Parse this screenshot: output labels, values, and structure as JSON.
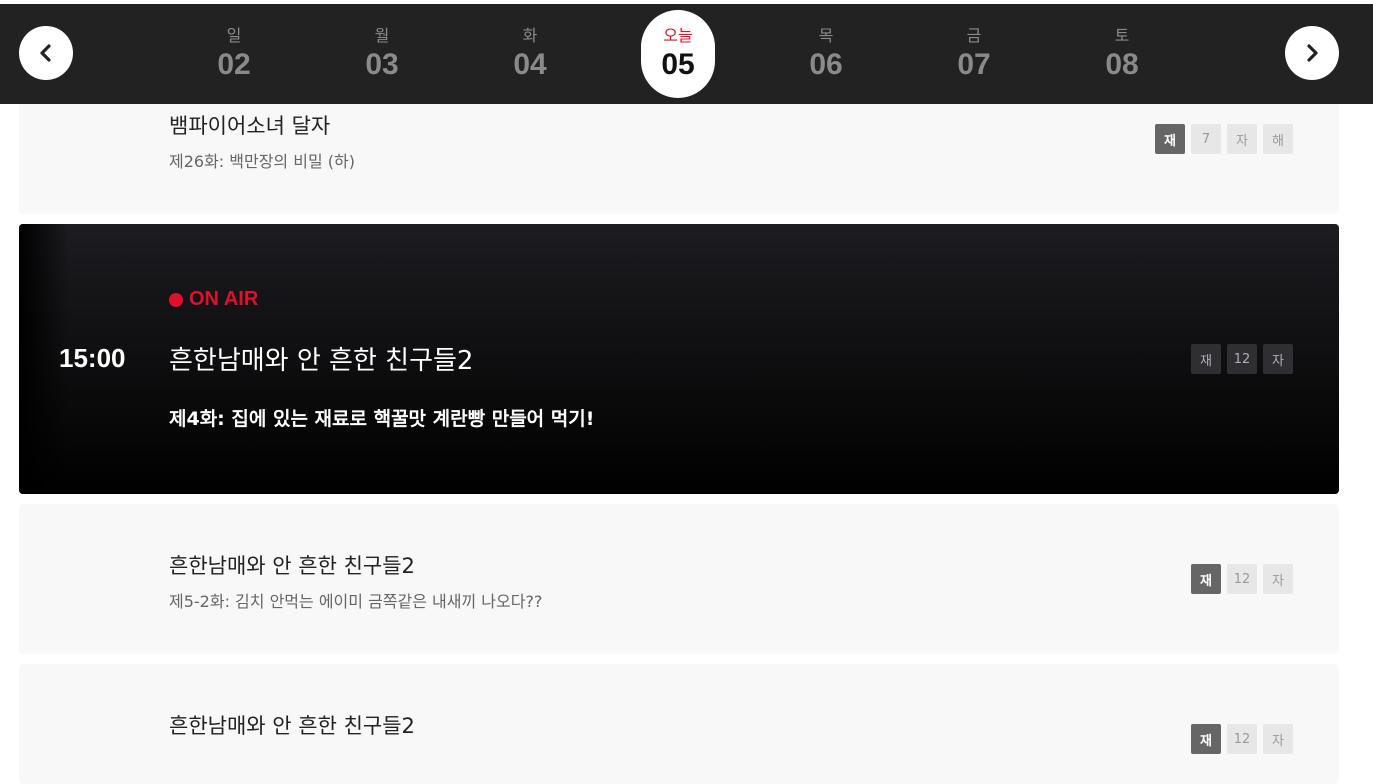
{
  "days": [
    {
      "dow": "일",
      "num": "02"
    },
    {
      "dow": "월",
      "num": "03"
    },
    {
      "dow": "화",
      "num": "04"
    },
    {
      "dow": "오늘",
      "num": "05"
    },
    {
      "dow": "목",
      "num": "06"
    },
    {
      "dow": "금",
      "num": "07"
    },
    {
      "dow": "토",
      "num": "08"
    }
  ],
  "programs": [
    {
      "title": "뱀파이어소녀 달자",
      "episode": "제26화: 백만장의 비밀 (하)",
      "badges": [
        "재",
        "7",
        "자",
        "해"
      ]
    },
    {
      "status": "ON AIR",
      "time": "15:00",
      "title": "흔한남매와 안 흔한 친구들2",
      "episode": "제4화: 집에 있는 재료로 핵꿀맛 계란빵 만들어 먹기!",
      "badges": [
        "재",
        "12",
        "자"
      ]
    },
    {
      "title": "흔한남매와 안 흔한 친구들2",
      "episode": "제5-2화: 김치 안먹는 에이미 금쪽같은 내새끼 나오다??",
      "badges": [
        "재",
        "12",
        "자"
      ]
    },
    {
      "title": "흔한남매와 안 흔한 친구들2",
      "badges": [
        "재",
        "12",
        "자"
      ]
    }
  ],
  "colors": {
    "topbar": "#222222",
    "accent": "#e0102a"
  },
  "icons": {
    "prev": "chevron-left-icon",
    "next": "chevron-right-icon"
  }
}
